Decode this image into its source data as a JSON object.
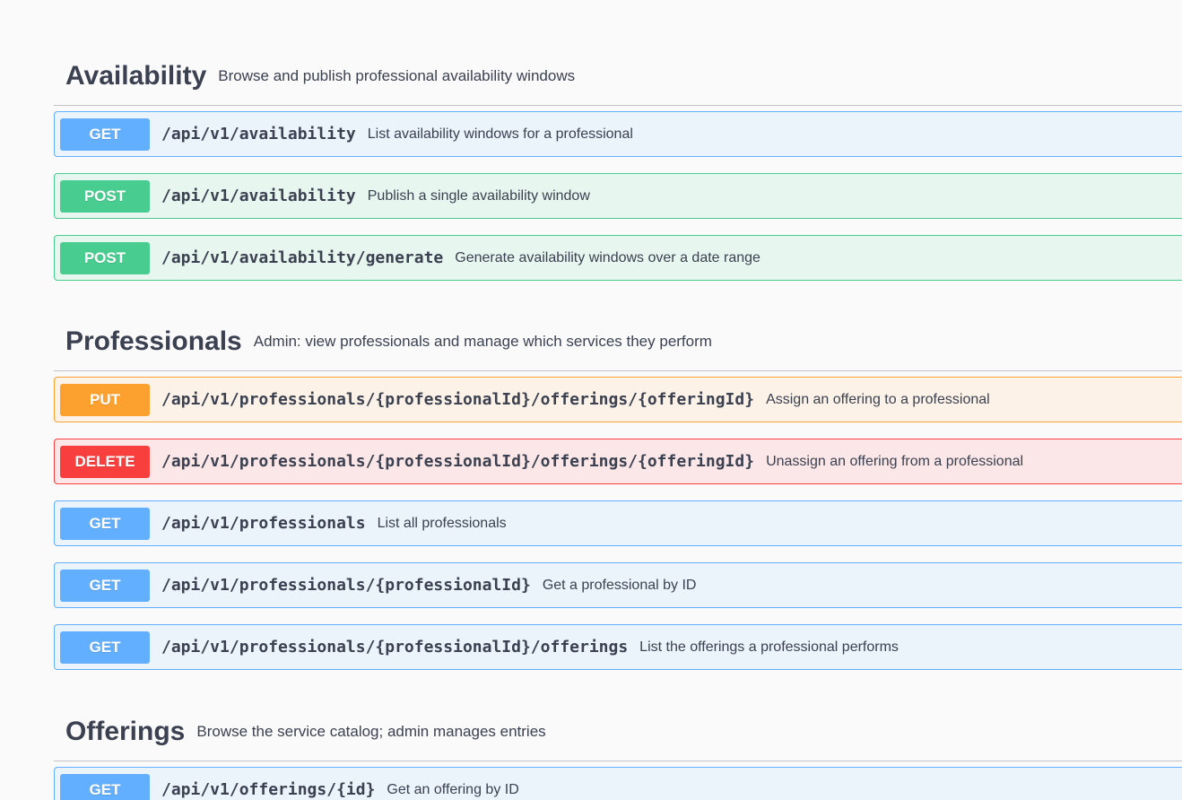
{
  "sections": [
    {
      "name": "Availability",
      "description": "Browse and publish professional availability windows",
      "operations": [
        {
          "method": "GET",
          "path": "/api/v1/availability",
          "summary": "List availability windows for a professional"
        },
        {
          "method": "POST",
          "path": "/api/v1/availability",
          "summary": "Publish a single availability window"
        },
        {
          "method": "POST",
          "path": "/api/v1/availability/generate",
          "summary": "Generate availability windows over a date range"
        }
      ]
    },
    {
      "name": "Professionals",
      "description": "Admin: view professionals and manage which services they perform",
      "operations": [
        {
          "method": "PUT",
          "path": "/api/v1/professionals/{professionalId}/offerings/{offeringId}",
          "summary": "Assign an offering to a professional"
        },
        {
          "method": "DELETE",
          "path": "/api/v1/professionals/{professionalId}/offerings/{offeringId}",
          "summary": "Unassign an offering from a professional"
        },
        {
          "method": "GET",
          "path": "/api/v1/professionals",
          "summary": "List all professionals"
        },
        {
          "method": "GET",
          "path": "/api/v1/professionals/{professionalId}",
          "summary": "Get a professional by ID"
        },
        {
          "method": "GET",
          "path": "/api/v1/professionals/{professionalId}/offerings",
          "summary": "List the offerings a professional performs"
        }
      ]
    },
    {
      "name": "Offerings",
      "description": "Browse the service catalog; admin manages entries",
      "operations": [
        {
          "method": "GET",
          "path": "/api/v1/offerings/{id}",
          "summary": "Get an offering by ID"
        }
      ]
    }
  ],
  "colors": {
    "get": "#61affe",
    "post": "#49cc90",
    "put": "#fca130",
    "delete": "#f93e3e",
    "text": "#3b4151",
    "background": "#fafafa"
  }
}
